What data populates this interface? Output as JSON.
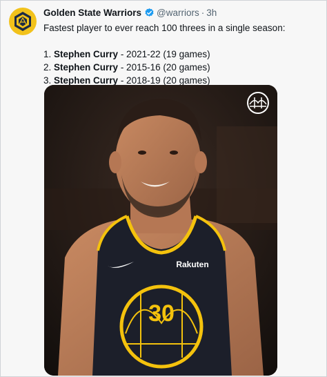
{
  "tweet": {
    "author_name": "Golden State Warriors",
    "handle": "@warriors",
    "separator": "·",
    "time": "3h",
    "text": "Fastest player to ever reach 100 threes in a single season:",
    "list": [
      {
        "rank": "1.",
        "player": "Stephen Curry",
        "detail": " - 2021-22 (19 games)"
      },
      {
        "rank": "2.",
        "player": "Stephen Curry",
        "detail": " - 2015-16 (20 games)"
      },
      {
        "rank": "3.",
        "player": "Stephen Curry",
        "detail": " - 2018-19 (20 games)"
      }
    ]
  },
  "media": {
    "jersey_number": "30",
    "jersey_sponsor": "Rakuten"
  },
  "colors": {
    "avatar_bg": "#f2c21b",
    "verified": "#1d9bf0",
    "jersey": "#1c1f2a",
    "trim": "#f4c20d"
  },
  "icons": {
    "avatar": "warriors-logo-icon",
    "verified": "verified-badge-icon",
    "media_logo": "bridge-logo-icon"
  }
}
